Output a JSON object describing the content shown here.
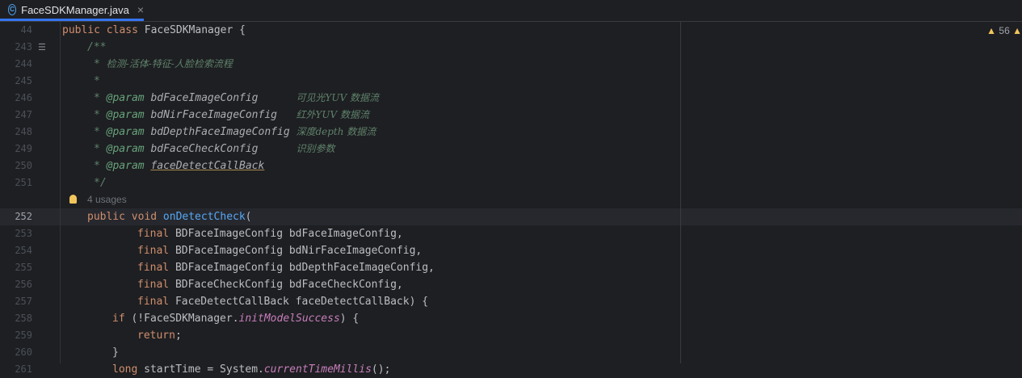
{
  "tab": {
    "icon": "C",
    "title": "FaceSDKManager.java",
    "close": "×"
  },
  "warnings": {
    "count": "56"
  },
  "sticky": {
    "num": "44",
    "code": "public class FaceSDKManager {"
  },
  "lines": [
    {
      "num": "243"
    },
    {
      "num": "244"
    },
    {
      "num": "245"
    },
    {
      "num": "246"
    },
    {
      "num": "247"
    },
    {
      "num": "248"
    },
    {
      "num": "249"
    },
    {
      "num": "250"
    },
    {
      "num": "251"
    },
    {
      "num": ""
    },
    {
      "num": "252"
    },
    {
      "num": "253"
    },
    {
      "num": "254"
    },
    {
      "num": "255"
    },
    {
      "num": "256"
    },
    {
      "num": "257"
    },
    {
      "num": "258"
    },
    {
      "num": "259"
    },
    {
      "num": "260"
    },
    {
      "num": "261"
    }
  ],
  "code": {
    "l243": "/**",
    "l244_star": "* ",
    "l244_text": "检测-活体-特征-人脸检索流程",
    "l245": "*",
    "params": [
      {
        "name": "bdFaceImageConfig",
        "pad": "      ",
        "desc": "可见光YUV 数据流"
      },
      {
        "name": "bdNirFaceImageConfig",
        "pad": "   ",
        "desc": "红外YUV 数据流"
      },
      {
        "name": "bdDepthFaceImageConfig",
        "pad": " ",
        "desc": "深度depth 数据流"
      },
      {
        "name": "bdFaceCheckConfig",
        "pad": "      ",
        "desc": "识别参数"
      },
      {
        "name": "faceDetectCallBack",
        "pad": "",
        "desc": ""
      }
    ],
    "param_star": "* ",
    "param_tag": "@param",
    "l251": "*/",
    "usages": "4 usages",
    "l252_kw": "public void",
    "l252_fn": "onDetectCheck",
    "l252_rest": "(",
    "args": [
      {
        "type": "BDFaceImageConfig",
        "name": "bdFaceImageConfig,"
      },
      {
        "type": "BDFaceImageConfig",
        "name": "bdNirFaceImageConfig,"
      },
      {
        "type": "BDFaceImageConfig",
        "name": "bdDepthFaceImageConfig,"
      },
      {
        "type": "BDFaceCheckConfig",
        "name": "bdFaceCheckConfig,"
      },
      {
        "type": "FaceDetectCallBack",
        "name": "faceDetectCallBack) {"
      }
    ],
    "final_kw": "final",
    "l258_kw": "if",
    "l258_a": " (!FaceSDKManager.",
    "l258_static": "initModelSuccess",
    "l258_b": ") {",
    "l259_kw": "return",
    "l259_b": ";",
    "l260": "}",
    "l261": "long startTime = System.currentTimeMillis();"
  }
}
